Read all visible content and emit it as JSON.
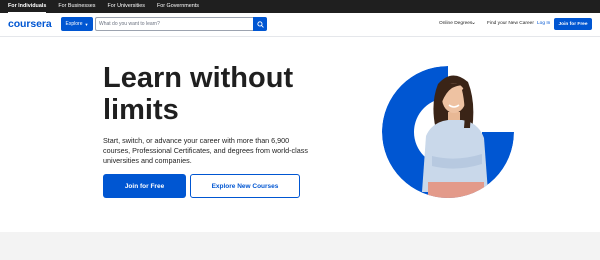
{
  "audience_nav": {
    "items": [
      {
        "label": "For Individuals",
        "active": true
      },
      {
        "label": "For Businesses",
        "active": false
      },
      {
        "label": "For Universities",
        "active": false
      },
      {
        "label": "For Governments",
        "active": false
      }
    ]
  },
  "header": {
    "logo": "coursera",
    "explore_label": "Explore",
    "search_placeholder": "What do you want to learn?",
    "search_icon": "search-icon",
    "nav_degrees": "Online Degrees",
    "nav_career": "Find your New Career",
    "login_label": "Log In",
    "join_label": "Join for Free"
  },
  "hero": {
    "title_line1": "Learn without",
    "title_line2": "limits",
    "subtitle": "Start, switch, or advance your career with more than 6,900 courses, Professional Certificates, and degrees from world-class universities and companies.",
    "primary_cta": "Join for Free",
    "secondary_cta": "Explore New Courses"
  },
  "colors": {
    "brand_blue": "#0056d2",
    "top_bar": "#1f1f1f",
    "text": "#1f1f1f",
    "band": "#f3f3f3"
  }
}
